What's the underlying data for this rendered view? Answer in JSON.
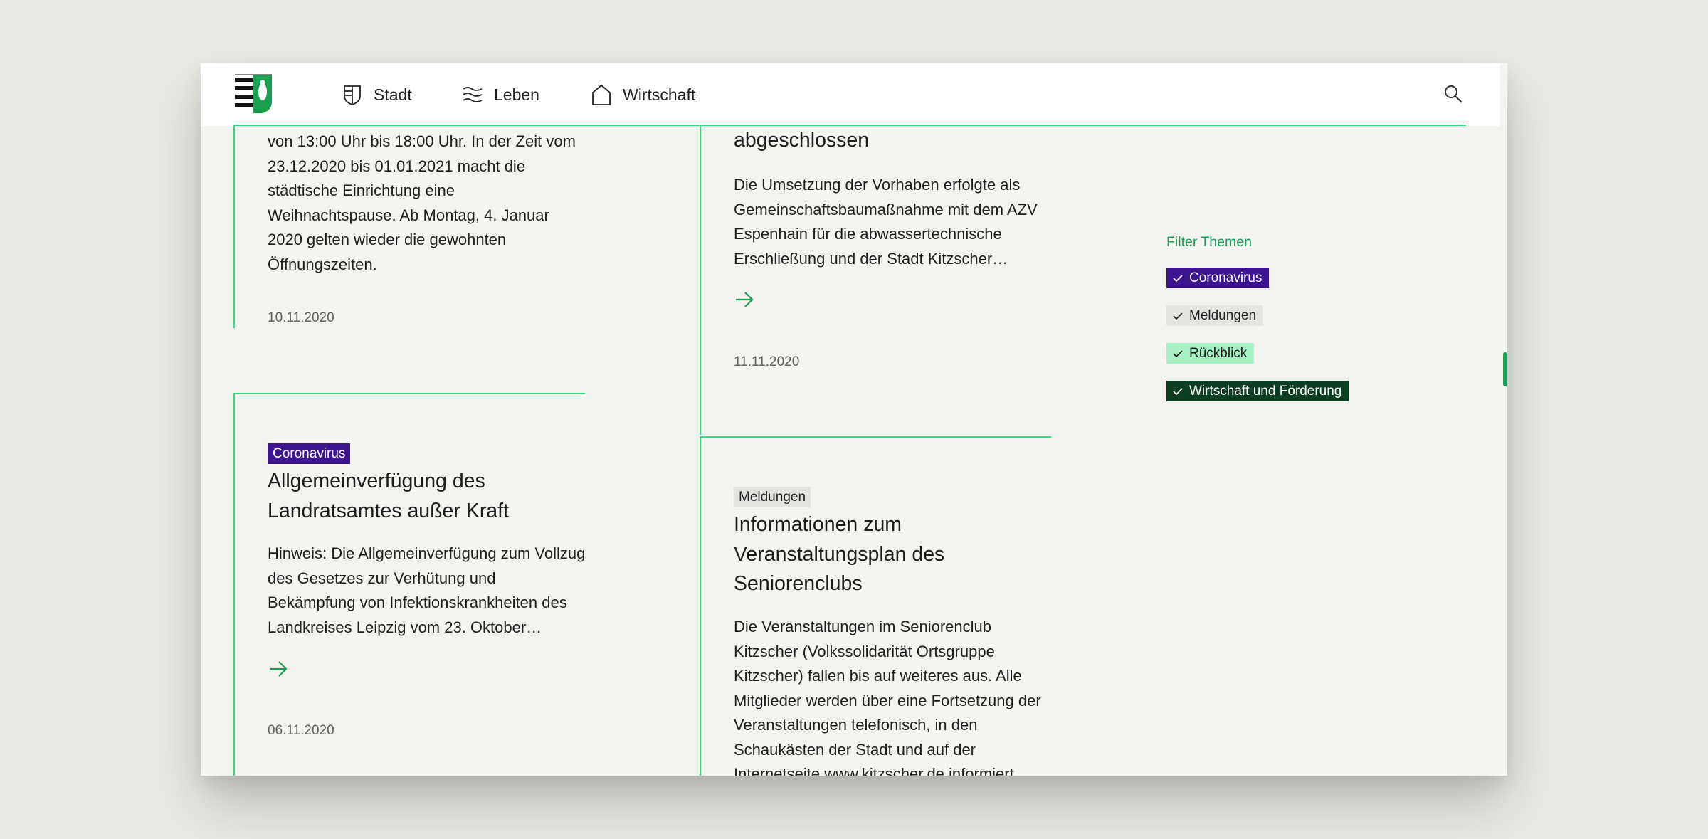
{
  "nav": {
    "items": [
      {
        "label": "Stadt",
        "icon": "shield-icon"
      },
      {
        "label": "Leben",
        "icon": "waves-icon"
      },
      {
        "label": "Wirtschaft",
        "icon": "house-icon"
      }
    ],
    "search_icon": "search-icon",
    "logo": "city-crest-logo"
  },
  "posts": [
    {
      "excerpt_lines": [
        "von 13:00 Uhr bis 18:00 Uhr. In der Zeit vom",
        "23.12.2020 bis 01.01.2021 macht die",
        "städtische Einrichtung eine",
        "Weihnachtspause. Ab Montag, 4. Januar",
        "2020 gelten wieder die gewohnten",
        "Öffnungszeiten."
      ],
      "date": "10.11.2020"
    },
    {
      "title_lines": [
        "abgeschlossen"
      ],
      "excerpt_lines": [
        "Die Umsetzung der Vorhaben erfolgte als",
        "Gemeinschaftsbaumaßnahme mit dem AZV",
        "Espenhain für die abwassertechnische",
        "Erschließung und der Stadt Kitzscher…"
      ],
      "date": "11.11.2020"
    },
    {
      "tag": "Coronavirus",
      "title_lines": [
        "Allgemeinverfügung des",
        "Landratsamtes außer Kraft"
      ],
      "excerpt_lines": [
        "Hinweis: Die Allgemeinverfügung zum Vollzug",
        "des Gesetzes zur Verhütung und",
        "Bekämpfung von Infektionskrankheiten des",
        "Landkreises Leipzig vom 23. Oktober…"
      ],
      "date": "06.11.2020"
    },
    {
      "tag": "Meldungen",
      "title_lines": [
        "Informationen zum",
        "Veranstaltungsplan des",
        "Seniorenclubs"
      ],
      "excerpt_lines": [
        "Die Veranstaltungen im Seniorenclub",
        "Kitzscher (Volkssolidarität Ortsgruppe",
        "Kitzscher) fallen bis auf weiteres aus. Alle",
        "Mitglieder werden über eine Fortsetzung der",
        "Veranstaltungen telefonisch, in den",
        "Schaukästen der Stadt und auf der",
        "Internetseite www.kitzscher.de informiert."
      ]
    }
  ],
  "filter": {
    "title": "Filter Themen",
    "chips": [
      {
        "label": "Coronavirus",
        "checked": true,
        "color": "#3c1591"
      },
      {
        "label": "Meldungen",
        "checked": true,
        "color": "#e4e4e1"
      },
      {
        "label": "Rückblick",
        "checked": true,
        "color": "#a7f0c6"
      },
      {
        "label": "Wirtschaft und Förderung",
        "checked": true,
        "color": "#0b3e22"
      }
    ]
  },
  "colors": {
    "accent_green": "#37d680",
    "arrow_green": "#1b9e58",
    "page_bg": "#f3f3f0"
  }
}
